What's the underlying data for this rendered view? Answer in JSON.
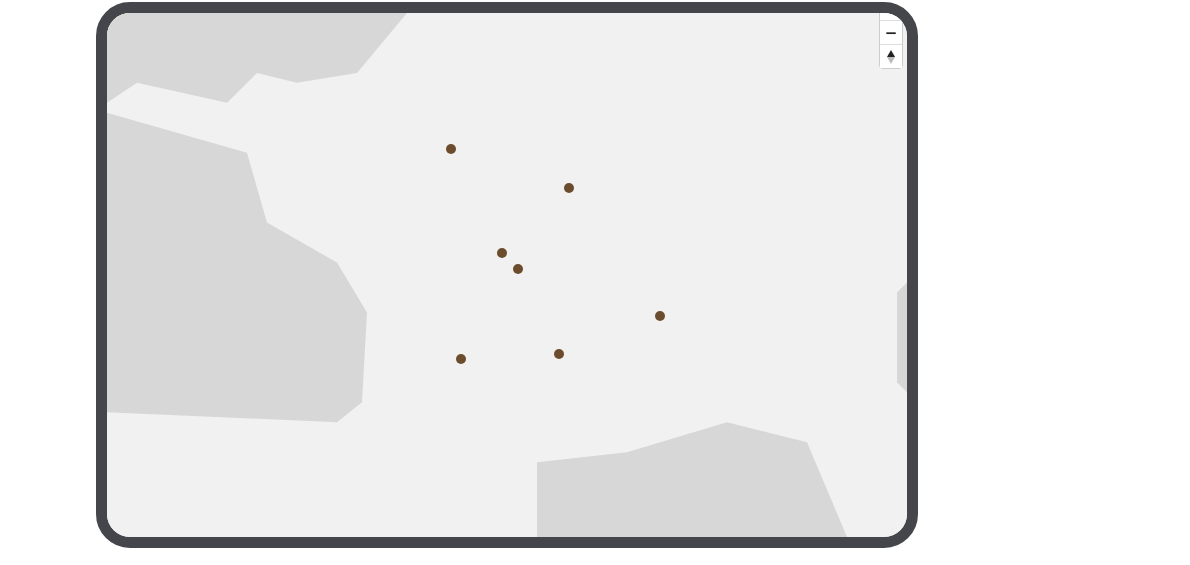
{
  "map": {
    "controls": [
      {
        "kind": "zoom-out",
        "label": "−"
      },
      {
        "kind": "compass"
      }
    ]
  }
}
